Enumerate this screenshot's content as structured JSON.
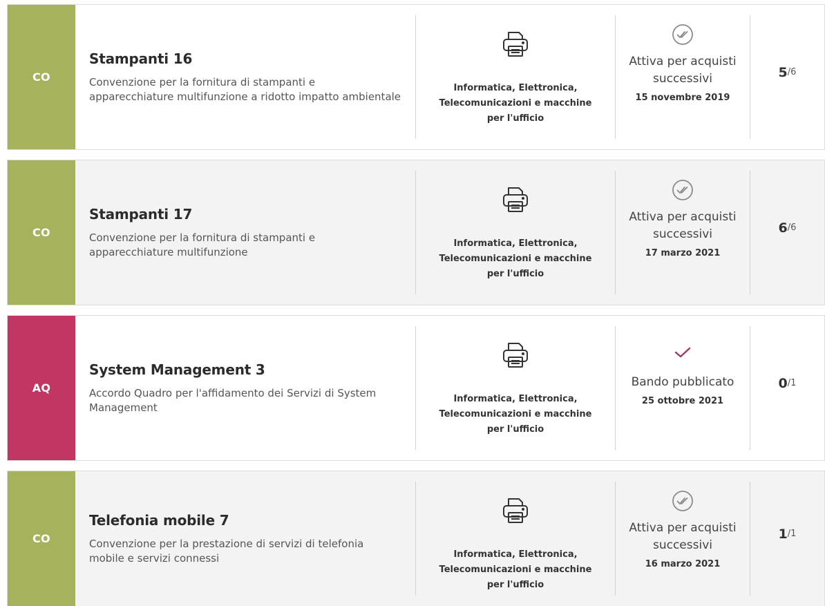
{
  "colors": {
    "co": "#a7b35c",
    "aq": "#c13663",
    "check_done": "#8a8a8a",
    "check_published": "#a23a5f"
  },
  "items": [
    {
      "badge": "CO",
      "title": "Stampanti 16",
      "description": "Convenzione per la fornitura di stampanti e apparecchiature multifunzione a ridotto impatto ambientale",
      "category_icon": "printer-icon",
      "category": "Informatica, Elettronica, Telecomunicazioni e macchine per l'ufficio",
      "status_icon": "double-check-circle-icon",
      "status": "Attiva per acquisti successivi",
      "date": "15 novembre 2019",
      "count": "5",
      "total": "/6"
    },
    {
      "badge": "CO",
      "title": "Stampanti 17",
      "description": "Convenzione per la fornitura di stampanti e apparecchiature multifunzione",
      "category_icon": "printer-icon",
      "category": "Informatica, Elettronica, Telecomunicazioni e macchine per l'ufficio",
      "status_icon": "double-check-circle-icon",
      "status": "Attiva per acquisti successivi",
      "date": "17 marzo 2021",
      "count": "6",
      "total": "/6"
    },
    {
      "badge": "AQ",
      "title": "System Management 3",
      "description": "Accordo Quadro per l'affidamento dei Servizi di System Management",
      "category_icon": "printer-icon",
      "category": "Informatica, Elettronica, Telecomunicazioni e macchine per l'ufficio",
      "status_icon": "check-icon",
      "status": "Bando pubblicato",
      "date": "25 ottobre 2021",
      "count": "0",
      "total": "/1"
    },
    {
      "badge": "CO",
      "title": "Telefonia mobile 7",
      "description": "Convenzione per la prestazione di servizi di telefonia mobile e servizi connessi",
      "category_icon": "printer-icon",
      "category": "Informatica, Elettronica, Telecomunicazioni e macchine per l'ufficio",
      "status_icon": "double-check-circle-icon",
      "status": "Attiva per acquisti successivi",
      "date": "16 marzo 2021",
      "count": "1",
      "total": "/1"
    }
  ]
}
